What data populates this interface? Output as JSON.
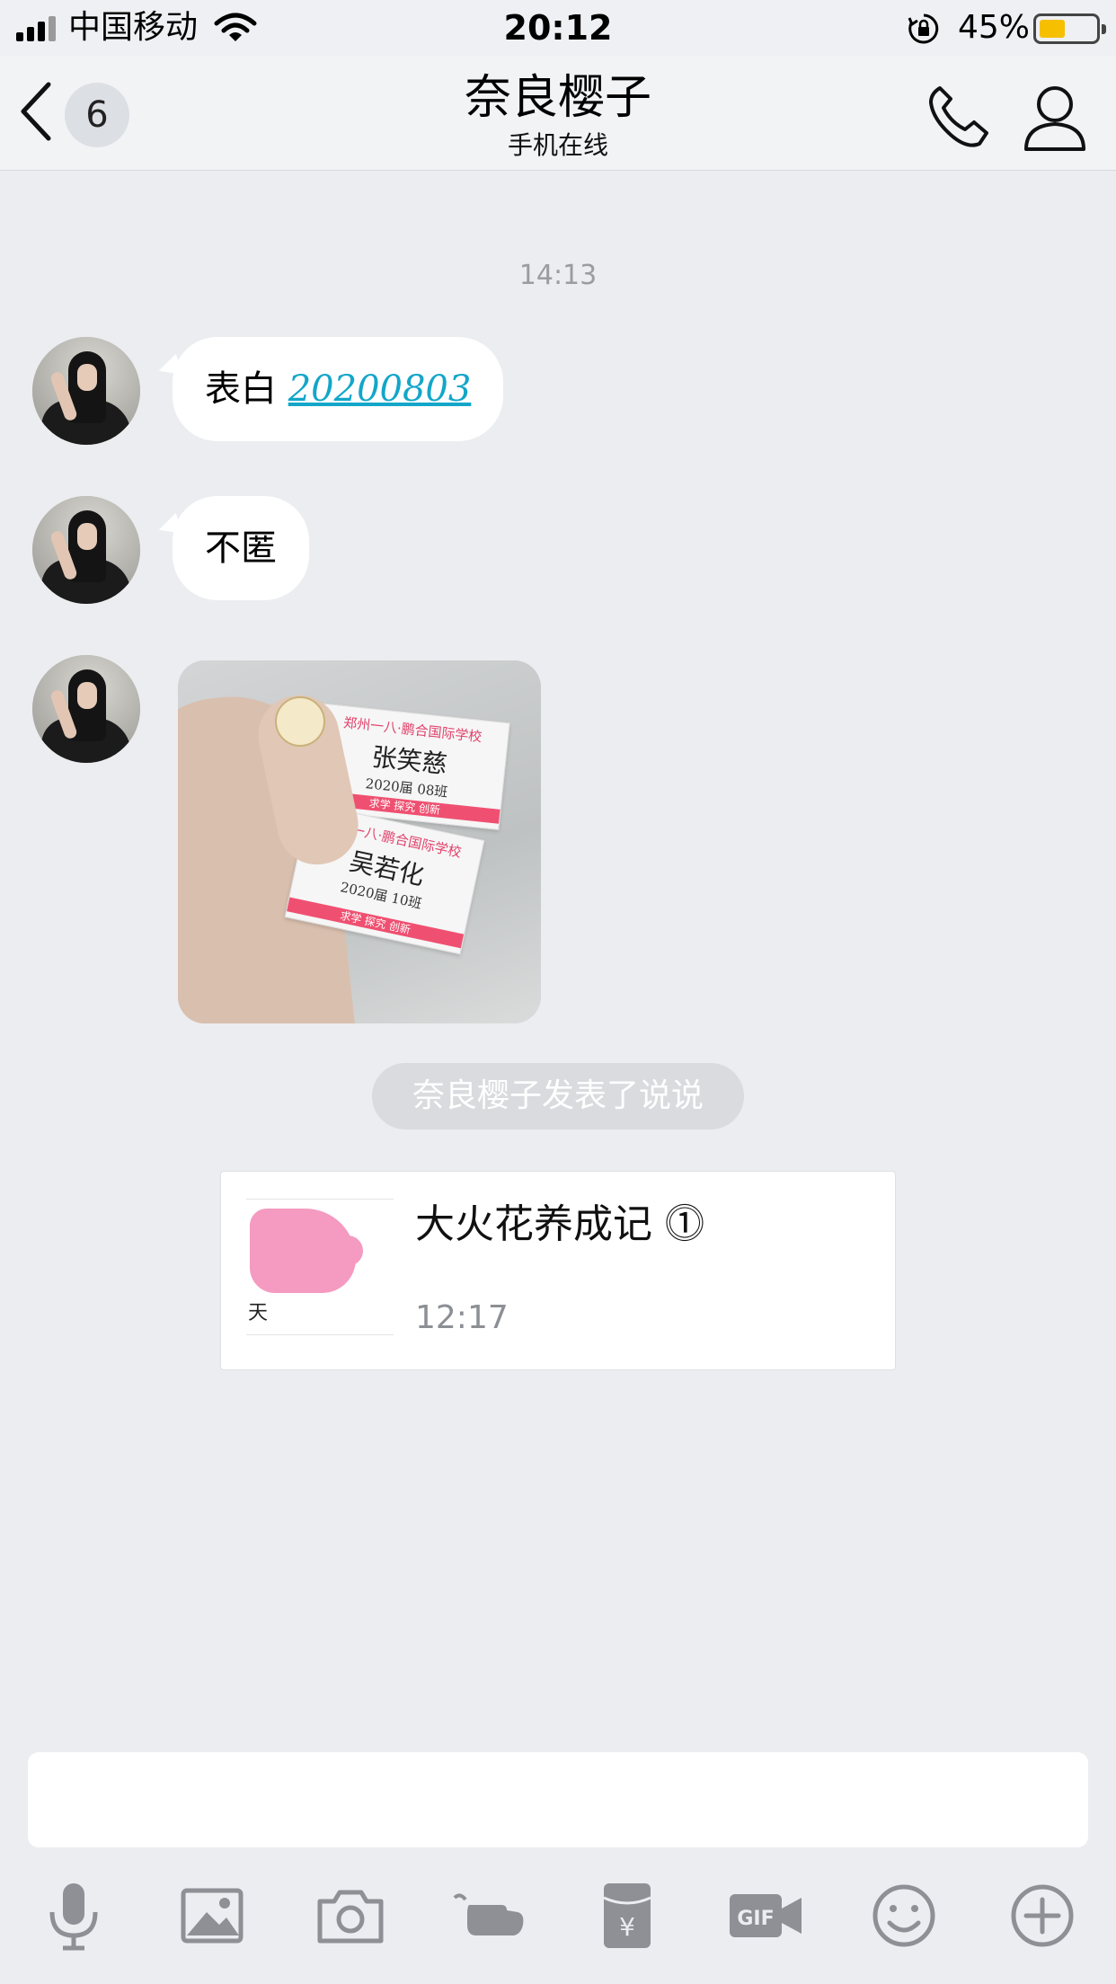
{
  "status_bar": {
    "carrier": "中国移动",
    "time": "20:12",
    "battery_percent": "45%",
    "battery_level": 0.45,
    "icons": [
      "signal-icon",
      "wifi-icon",
      "rotation-lock-icon",
      "battery-icon"
    ]
  },
  "nav": {
    "back_icon": "chevron-left-icon",
    "unread_count": "6",
    "title": "奈良樱子",
    "subtitle": "手机在线",
    "call_icon": "phone-icon",
    "profile_icon": "person-icon"
  },
  "chat": {
    "timestamp": "14:13",
    "messages": [
      {
        "type": "text",
        "prefix": "表白",
        "link": "20200803"
      },
      {
        "type": "text",
        "text": "不匿"
      },
      {
        "type": "image"
      }
    ],
    "photo": {
      "ticket1": {
        "school": "郑州一八·鹏合国际学校",
        "name": "张笑慈",
        "class": "2020届 08班",
        "motto": "求学 探究 创新"
      },
      "ticket2": {
        "school": "郑州一八·鹏合国际学校",
        "name": "吴若化",
        "class": "2020届 10班",
        "motto": "求学 探究 创新"
      }
    },
    "system_notice": "奈良樱子发表了说说",
    "card": {
      "thumb_text": "天",
      "title": "大火花养成记 ⓵",
      "time": "12:17"
    }
  },
  "input": {
    "placeholder": "",
    "value": ""
  },
  "toolbar": {
    "items": [
      "microphone-icon",
      "image-icon",
      "camera-icon",
      "poke-icon",
      "red-packet-icon",
      "gif-icon",
      "emoji-icon",
      "plus-icon"
    ]
  },
  "colors": {
    "background": "#ebedf0",
    "link": "#13a6c9",
    "battery": "#f6c000",
    "icon_gray": "#8e9096"
  }
}
